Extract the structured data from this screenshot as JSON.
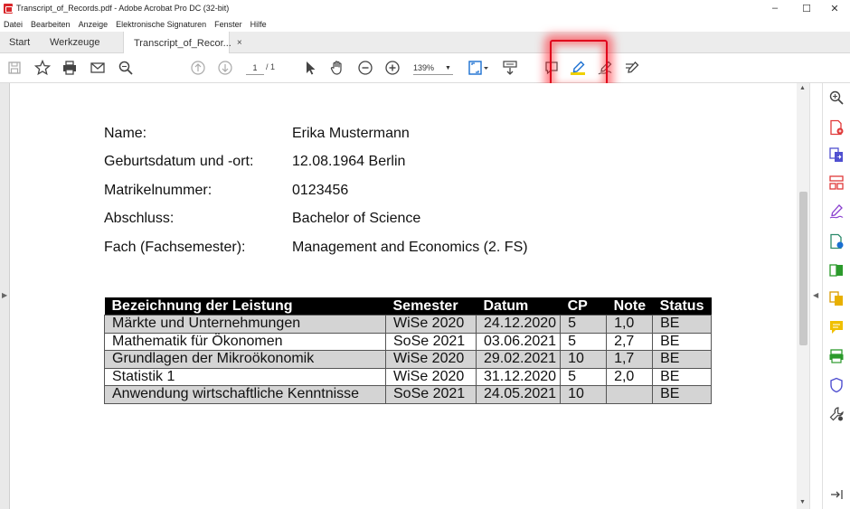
{
  "window": {
    "title": "Transcript_of_Records.pdf - Adobe Acrobat Pro DC (32-bit)",
    "minimize": "–",
    "maximize": "☐",
    "close": "✕"
  },
  "menu": [
    "Datei",
    "Bearbeiten",
    "Anzeige",
    "Elektronische Signaturen",
    "Fenster",
    "Hilfe"
  ],
  "tabs": {
    "start": "Start",
    "tools": "Werkzeuge",
    "document": "Transcript_of_Recor...",
    "close": "×"
  },
  "toolbar": {
    "page_current": "1",
    "page_total": "/ 1",
    "zoom": "139%",
    "zoom_chev": "▼"
  },
  "document": {
    "fields": [
      {
        "label": "Name:",
        "value": "Erika Mustermann"
      },
      {
        "label": "Geburtsdatum und -ort:",
        "value": "12.08.1964 Berlin"
      },
      {
        "label": "Matrikelnummer:",
        "value": "0123456"
      },
      {
        "label": "Abschluss:",
        "value": "Bachelor of Science"
      },
      {
        "label": "Fach (Fachsemester):",
        "value": "Management and Economics (2. FS)"
      }
    ],
    "table": {
      "headers": [
        "Bezeichnung der Leistung",
        "Semester",
        "Datum",
        "CP",
        "Note",
        "Status"
      ],
      "rows": [
        [
          "Märkte und Unternehmungen",
          "WiSe 2020",
          "24.12.2020",
          "5",
          "1,0",
          "BE"
        ],
        [
          "Mathematik für Ökonomen",
          "SoSe 2021",
          "03.06.2021",
          "5",
          "2,7",
          "BE"
        ],
        [
          "Grundlagen der Mikroökonomik",
          "WiSe 2020",
          "29.02.2021",
          "10",
          "1,7",
          "BE"
        ],
        [
          "Statistik 1",
          "WiSe 2020",
          "31.12.2020",
          "5",
          "2,0",
          "BE"
        ],
        [
          "Anwendung wirtschaftliche Kenntnisse",
          "SoSe 2021",
          "24.05.2021",
          "10",
          "",
          "BE"
        ]
      ]
    }
  },
  "colors": {
    "highlight": "#e0001b",
    "highlighter": "#f0d000"
  }
}
